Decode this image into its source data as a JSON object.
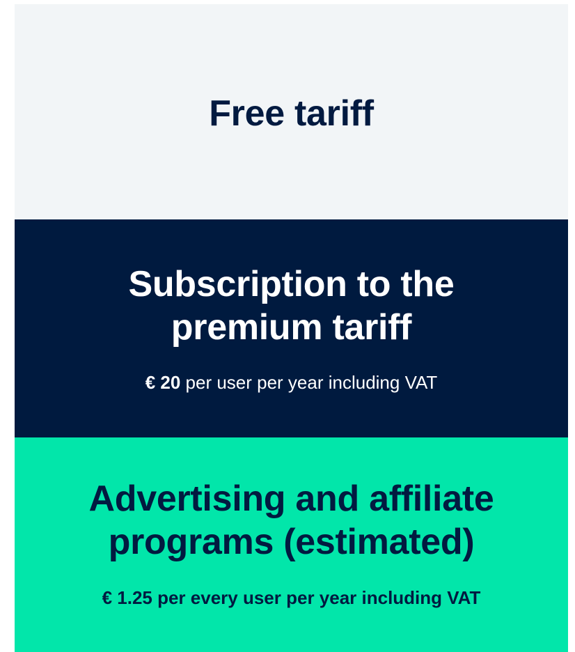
{
  "tiers": {
    "free": {
      "title": "Free tariff"
    },
    "premium": {
      "title_line1": "Subscription to the",
      "title_line2": "premium tariff",
      "price_amount": "€ 20",
      "price_detail": " per user per year including VAT"
    },
    "ads": {
      "title_line1": "Advertising and affiliate",
      "title_line2": "programs (estimated)",
      "price": "€ 1.25 per every user per year including VAT"
    }
  },
  "colors": {
    "free_bg": "#f2f5f7",
    "premium_bg": "#001a3f",
    "ads_bg": "#02e6aa",
    "dark_text": "#021a40",
    "light_text": "#ffffff"
  }
}
